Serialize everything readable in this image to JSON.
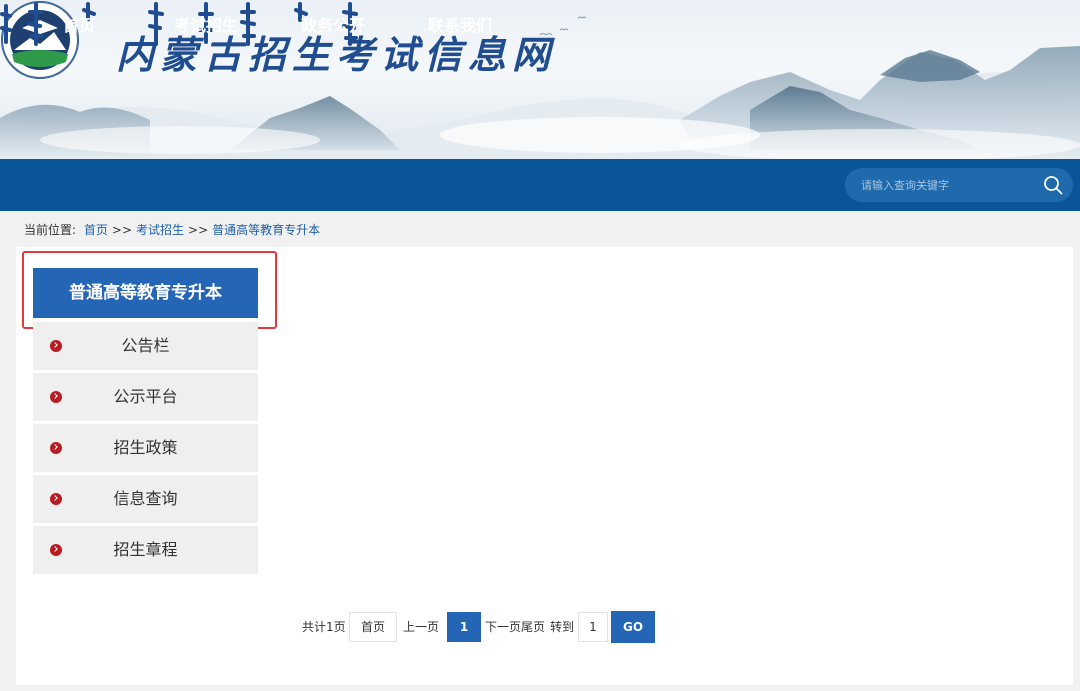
{
  "header": {
    "site_title": "内蒙古招生考试信息网"
  },
  "nav": {
    "items": [
      {
        "label": "首页"
      },
      {
        "label": "考试招生"
      },
      {
        "label": "政务公开"
      },
      {
        "label": "联系我们"
      }
    ],
    "search_placeholder": "请输入查询关键字"
  },
  "breadcrumb": {
    "prefix": "当前位置:",
    "items": [
      "首页",
      "考试招生",
      "普通高等教育专升本"
    ],
    "separator": ">>"
  },
  "sidebar": {
    "title": "普通高等教育专升本",
    "items": [
      {
        "label": "公告栏"
      },
      {
        "label": "公示平台"
      },
      {
        "label": "招生政策"
      },
      {
        "label": "信息查询"
      },
      {
        "label": "招生章程"
      }
    ]
  },
  "pagination": {
    "total_text": "共计1页",
    "first_label": "首页",
    "prev_label": "上一页",
    "current_page": "1",
    "next_last_text": "下一页尾页",
    "goto_label": "转到",
    "goto_value": "1",
    "go_label": "GO"
  },
  "colors": {
    "nav_bg": "#0a559a",
    "accent_blue": "#2466b5",
    "bullet_red": "#b81c22",
    "highlight_border": "#e23a3a"
  }
}
